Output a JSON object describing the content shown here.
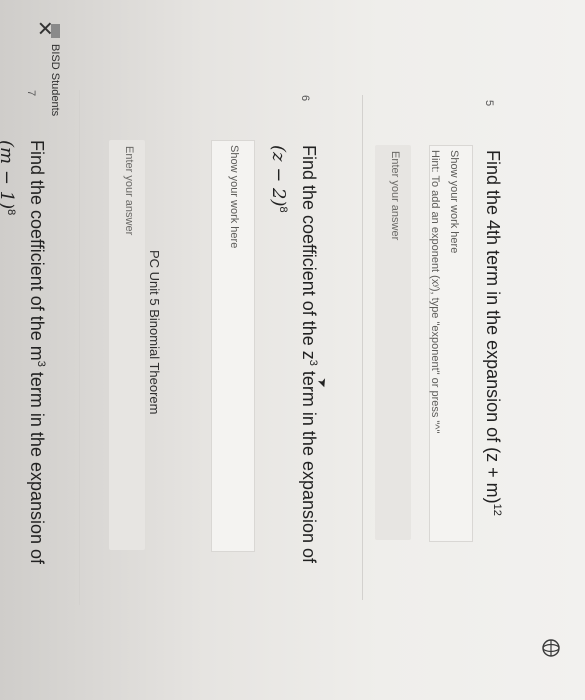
{
  "window": {
    "label": "BISD Students"
  },
  "page": {
    "title": "PC Unit 5 Binomial Theorem"
  },
  "questions": [
    {
      "number": "5",
      "text": "Find the 4th term in the expansion of (z + m)",
      "exponent": "12",
      "work_placeholder": "Show your work here",
      "hint": "Hint: To add an exponent (xʸ), type \"exponent\" or press \"^\"",
      "answer_placeholder": "Enter your answer"
    },
    {
      "number": "6",
      "text": "Find the coefficient of the z",
      "text_exp": "3",
      "text_after": " term in the expansion of",
      "expr": "(z − 2)",
      "expr_exp": "8",
      "work_placeholder": "Show your work here",
      "answer_placeholder": "Enter your answer"
    },
    {
      "number": "7",
      "text": "Find the coefficient of the m",
      "text_exp": "3",
      "text_after": " term in the expansion of",
      "expr": "(m − 1)",
      "expr_exp": "8"
    }
  ]
}
